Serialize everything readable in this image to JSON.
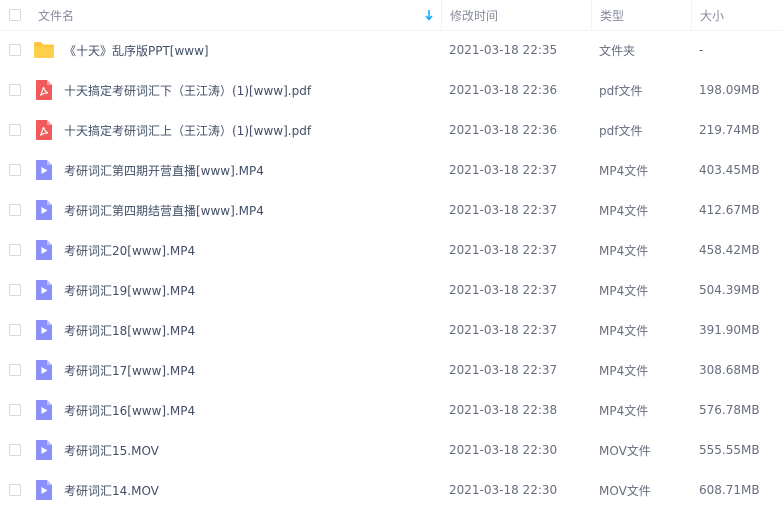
{
  "header": {
    "name_label": "文件名",
    "time_label": "修改时间",
    "type_label": "类型",
    "size_label": "大小"
  },
  "files": [
    {
      "name": "《十天》乱序版PPT[www]",
      "time": "2021-03-18 22:35",
      "type": "文件夹",
      "size": "-",
      "icon": "folder-icon"
    },
    {
      "name": "十天搞定考研词汇下（王江涛）(1)[www].pdf",
      "time": "2021-03-18 22:36",
      "type": "pdf文件",
      "size": "198.09MB",
      "icon": "pdf-icon"
    },
    {
      "name": "十天搞定考研词汇上（王江涛）(1)[www].pdf",
      "time": "2021-03-18 22:36",
      "type": "pdf文件",
      "size": "219.74MB",
      "icon": "pdf-icon"
    },
    {
      "name": "考研词汇第四期开营直播[www].MP4",
      "time": "2021-03-18 22:37",
      "type": "MP4文件",
      "size": "403.45MB",
      "icon": "video-icon"
    },
    {
      "name": "考研词汇第四期结营直播[www].MP4",
      "time": "2021-03-18 22:37",
      "type": "MP4文件",
      "size": "412.67MB",
      "icon": "video-icon"
    },
    {
      "name": "考研词汇20[www].MP4",
      "time": "2021-03-18 22:37",
      "type": "MP4文件",
      "size": "458.42MB",
      "icon": "video-icon"
    },
    {
      "name": "考研词汇19[www].MP4",
      "time": "2021-03-18 22:37",
      "type": "MP4文件",
      "size": "504.39MB",
      "icon": "video-icon"
    },
    {
      "name": "考研词汇18[www].MP4",
      "time": "2021-03-18 22:37",
      "type": "MP4文件",
      "size": "391.90MB",
      "icon": "video-icon"
    },
    {
      "name": "考研词汇17[www].MP4",
      "time": "2021-03-18 22:37",
      "type": "MP4文件",
      "size": "308.68MB",
      "icon": "video-icon"
    },
    {
      "name": "考研词汇16[www].MP4",
      "time": "2021-03-18 22:38",
      "type": "MP4文件",
      "size": "576.78MB",
      "icon": "video-icon"
    },
    {
      "name": "考研词汇15.MOV",
      "time": "2021-03-18 22:30",
      "type": "MOV文件",
      "size": "555.55MB",
      "icon": "video-icon"
    },
    {
      "name": "考研词汇14.MOV",
      "time": "2021-03-18 22:30",
      "type": "MOV文件",
      "size": "608.71MB",
      "icon": "video-icon"
    }
  ],
  "colors": {
    "folder": "#ffc53d",
    "pdf": "#f05a5a",
    "video": "#8a8ffb",
    "sort_arrow": "#06a7ff"
  }
}
